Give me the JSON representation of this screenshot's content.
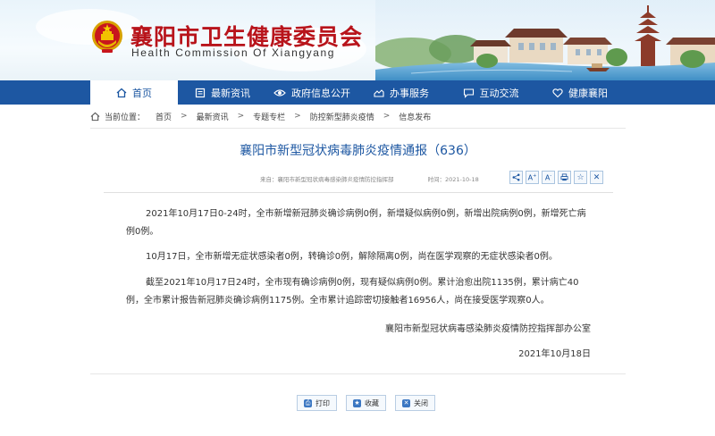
{
  "header": {
    "title": "襄阳市卫生健康委员会",
    "subtitle": "Health Commission Of Xiangyang"
  },
  "nav": {
    "items": [
      {
        "label": "首页",
        "icon": "home-icon",
        "active": true
      },
      {
        "label": "最新资讯",
        "icon": "news-icon"
      },
      {
        "label": "政府信息公开",
        "icon": "eye-icon"
      },
      {
        "label": "办事服务",
        "icon": "service-icon"
      },
      {
        "label": "互动交流",
        "icon": "chat-icon"
      },
      {
        "label": "健康襄阳",
        "icon": "heart-icon"
      }
    ]
  },
  "breadcrumb": {
    "prefix": "当前位置：",
    "items": [
      "首页",
      "最新资讯",
      "专题专栏",
      "防控新型肺炎疫情",
      "信息发布"
    ],
    "separator": ">"
  },
  "article": {
    "title": "襄阳市新型冠状病毒肺炎疫情通报（636）",
    "source": "来自：襄阳市新型冠状病毒感染肺炎疫情防控指挥部",
    "date_label": "时间：2021-10-18",
    "paragraphs": [
      "2021年10月17日0-24时，全市新增新冠肺炎确诊病例0例，新增疑似病例0例，新增出院病例0例，新增死亡病例0例。",
      "10月17日，全市新增无症状感染者0例，转确诊0例，解除隔离0例，尚在医学观察的无症状感染者0例。",
      "截至2021年10月17日24时，全市现有确诊病例0例，现有疑似病例0例。累计治愈出院1135例，累计病亡40例，全市累计报告新冠肺炎确诊病例1175例。全市累计追踪密切接触者16956人，尚在接受医学观察0人。"
    ],
    "signature": "襄阳市新型冠状病毒感染肺炎疫情防控指挥部办公室",
    "sign_date": "2021年10月18日"
  },
  "tools": [
    {
      "name": "share-icon",
      "glyph": "<"
    },
    {
      "name": "font-increase-icon",
      "glyph": "A+"
    },
    {
      "name": "font-decrease-icon",
      "glyph": "A-"
    },
    {
      "name": "print-icon",
      "glyph": "⎙"
    },
    {
      "name": "favorite-icon",
      "glyph": "☆"
    },
    {
      "name": "close-icon",
      "glyph": "✕"
    }
  ],
  "actions": {
    "print": "打印",
    "favorite": "收藏",
    "close": "关闭"
  },
  "colors": {
    "brand_red": "#b8141b",
    "nav_blue": "#1d57a2",
    "title_blue": "#1d57a2"
  }
}
